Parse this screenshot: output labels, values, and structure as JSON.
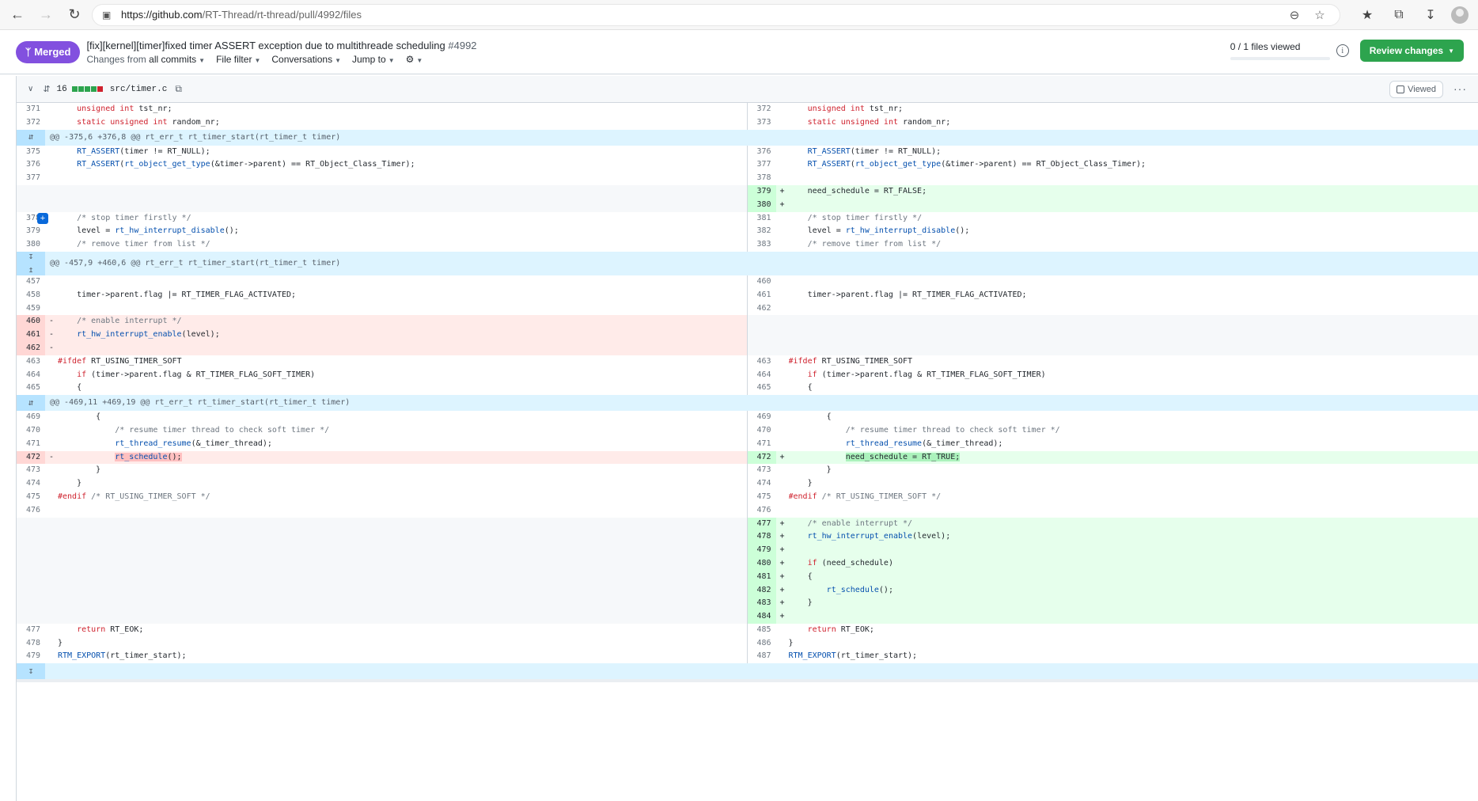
{
  "browser": {
    "url_host": "https://github.com",
    "url_path": "/RT-Thread/rt-thread/pull/4992/files"
  },
  "pr": {
    "status": "Merged",
    "title": "[fix][kernel][timer]fixed timer ASSERT exception due to multithreade scheduling",
    "number": "#4992",
    "changes_from_prefix": "Changes from",
    "changes_from_value": "all commits",
    "file_filter": "File filter",
    "conversations": "Conversations",
    "jump_to": "Jump to",
    "files_viewed": "0 / 1 files viewed",
    "review_button": "Review changes"
  },
  "file": {
    "changes": "16",
    "name": "src/timer.c",
    "viewed_label": "Viewed"
  },
  "hunks": {
    "h1": "@@ -375,6 +376,8 @@ rt_err_t rt_timer_start(rt_timer_t timer)",
    "h2": "@@ -457,9 +460,6 @@ rt_err_t rt_timer_start(rt_timer_t timer)",
    "h3": "@@ -469,11 +469,19 @@ rt_err_t rt_timer_start(rt_timer_t timer)"
  },
  "lines": {
    "l371": "371",
    "r372": "372",
    "l372": "372",
    "r373": "373",
    "l375": "375",
    "r376": "376",
    "l376": "376",
    "r377": "377",
    "l377": "377",
    "r378": "378",
    "r379": "379",
    "r380": "380",
    "l378": "378",
    "r381": "381",
    "l379": "379",
    "r382": "382",
    "l380": "380",
    "r383": "383",
    "l457": "457",
    "r460": "460",
    "l458": "458",
    "r461": "461",
    "l459": "459",
    "r462": "462",
    "l460": "460",
    "l461": "461",
    "l462": "462",
    "l463": "463",
    "r463": "463",
    "l464": "464",
    "r464": "464",
    "l465": "465",
    "r465": "465",
    "l469": "469",
    "r469": "469",
    "l470": "470",
    "r470": "470",
    "l471": "471",
    "r471": "471",
    "l472": "472",
    "r472": "472",
    "l473": "473",
    "r473": "473",
    "l474": "474",
    "r474": "474",
    "l475": "475",
    "r475": "475",
    "l476": "476",
    "r476": "476",
    "r477": "477",
    "r478": "478",
    "r479": "479",
    "r480": "480",
    "r481": "481",
    "r482": "482",
    "r483": "483",
    "r484": "484",
    "l477": "477",
    "r485": "485",
    "l478": "478",
    "r486": "486",
    "l479": "479",
    "r487": "487"
  }
}
